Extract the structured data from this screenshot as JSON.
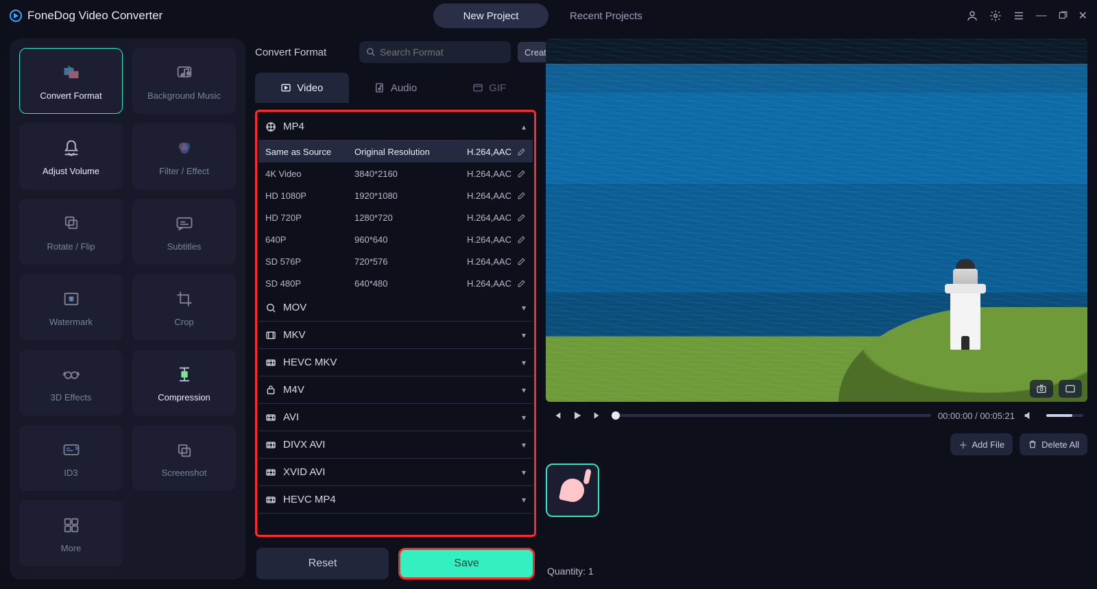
{
  "app": {
    "title": "FoneDog Video Converter"
  },
  "header": {
    "tabs": [
      {
        "label": "New Project",
        "active": true
      },
      {
        "label": "Recent Projects",
        "active": false
      }
    ]
  },
  "sidebar": {
    "tools": [
      {
        "id": "convert-format",
        "label": "Convert Format",
        "icon": "convert-icon",
        "state": "active"
      },
      {
        "id": "background-music",
        "label": "Background Music",
        "icon": "music-icon",
        "state": ""
      },
      {
        "id": "adjust-volume",
        "label": "Adjust Volume",
        "icon": "bell-icon",
        "state": "on"
      },
      {
        "id": "filter-effect",
        "label": "Filter / Effect",
        "icon": "filter-icon",
        "state": ""
      },
      {
        "id": "rotate-flip",
        "label": "Rotate / Flip",
        "icon": "rotate-icon",
        "state": ""
      },
      {
        "id": "subtitles",
        "label": "Subtitles",
        "icon": "subtitles-icon",
        "state": ""
      },
      {
        "id": "watermark",
        "label": "Watermark",
        "icon": "watermark-icon",
        "state": ""
      },
      {
        "id": "crop",
        "label": "Crop",
        "icon": "crop-icon",
        "state": ""
      },
      {
        "id": "3d-effects",
        "label": "3D Effects",
        "icon": "glasses-icon",
        "state": ""
      },
      {
        "id": "compression",
        "label": "Compression",
        "icon": "compress-icon",
        "state": "on"
      },
      {
        "id": "id3",
        "label": "ID3",
        "icon": "id3-icon",
        "state": ""
      },
      {
        "id": "screenshot",
        "label": "Screenshot",
        "icon": "screenshot-icon",
        "state": ""
      },
      {
        "id": "more",
        "label": "More",
        "icon": "more-icon",
        "state": ""
      }
    ]
  },
  "panel": {
    "title": "Convert Format",
    "search_placeholder": "Search Format",
    "create_label": "Create",
    "tabs": [
      {
        "id": "video",
        "label": "Video",
        "active": true
      },
      {
        "id": "audio",
        "label": "Audio",
        "active": false
      },
      {
        "id": "gif",
        "label": "GIF",
        "active": false,
        "dim": true
      }
    ],
    "open_format": "MP4",
    "presets": [
      {
        "name": "Same as Source",
        "res": "Original Resolution",
        "codec": "H.264,AAC",
        "sel": true
      },
      {
        "name": "4K Video",
        "res": "3840*2160",
        "codec": "H.264,AAC"
      },
      {
        "name": "HD 1080P",
        "res": "1920*1080",
        "codec": "H.264,AAC"
      },
      {
        "name": "HD 720P",
        "res": "1280*720",
        "codec": "H.264,AAC"
      },
      {
        "name": "640P",
        "res": "960*640",
        "codec": "H.264,AAC"
      },
      {
        "name": "SD 576P",
        "res": "720*576",
        "codec": "H.264,AAC"
      },
      {
        "name": "SD 480P",
        "res": "640*480",
        "codec": "H.264,AAC"
      }
    ],
    "collapsed_formats": [
      "MOV",
      "MKV",
      "HEVC MKV",
      "M4V",
      "AVI",
      "DIVX AVI",
      "XVID AVI",
      "HEVC MP4"
    ],
    "reset_label": "Reset",
    "save_label": "Save"
  },
  "player": {
    "time_current": "00:00:00",
    "time_total": "00:05:21"
  },
  "files": {
    "add_label": "Add File",
    "delete_label": "Delete All",
    "quantity_label": "Quantity: 1"
  }
}
